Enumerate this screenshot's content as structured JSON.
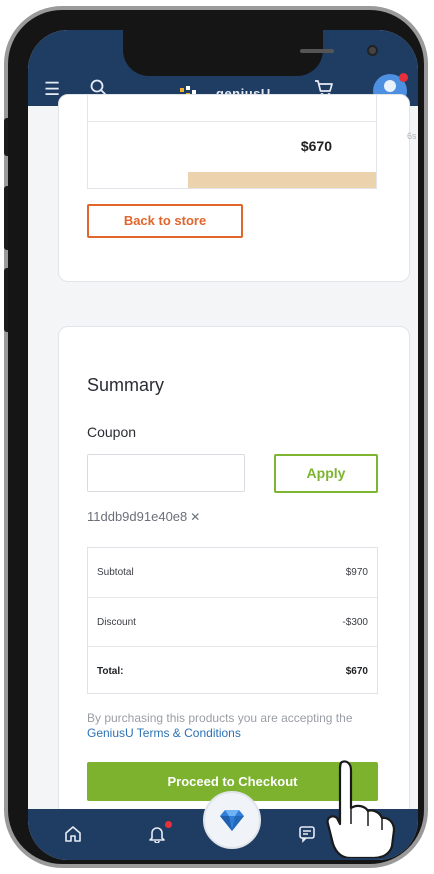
{
  "app": {
    "logo_text": "geniusU",
    "side_fragment": "6s"
  },
  "cart_card": {
    "row_amount": "$670",
    "back_button": "Back to store"
  },
  "summary": {
    "title": "Summary",
    "coupon_label": "Coupon",
    "coupon_input_value": "",
    "apply_button": "Apply",
    "applied_code": "11ddb9d91e40e8",
    "remove_icon": "✕",
    "rows": [
      {
        "label": "Subtotal",
        "value": "$970"
      },
      {
        "label": "Discount",
        "value": "-$300"
      },
      {
        "label": "Total:",
        "value": "$670"
      }
    ],
    "terms_prefix": "By purchasing this products you are accepting the ",
    "terms_link": "GeniusU Terms & Conditions",
    "checkout_button": "Proceed to Checkout"
  },
  "icons": {
    "menu": "menu-icon",
    "search": "search-icon",
    "cart": "cart-icon",
    "home": "home-icon",
    "bell": "bell-icon",
    "gem": "diamond-icon",
    "chat": "chat-icon"
  },
  "colors": {
    "navy": "#1f3c63",
    "green": "#7cb22e",
    "orange": "#e0662c",
    "notification": "#e8303a",
    "link": "#2c71b6"
  }
}
